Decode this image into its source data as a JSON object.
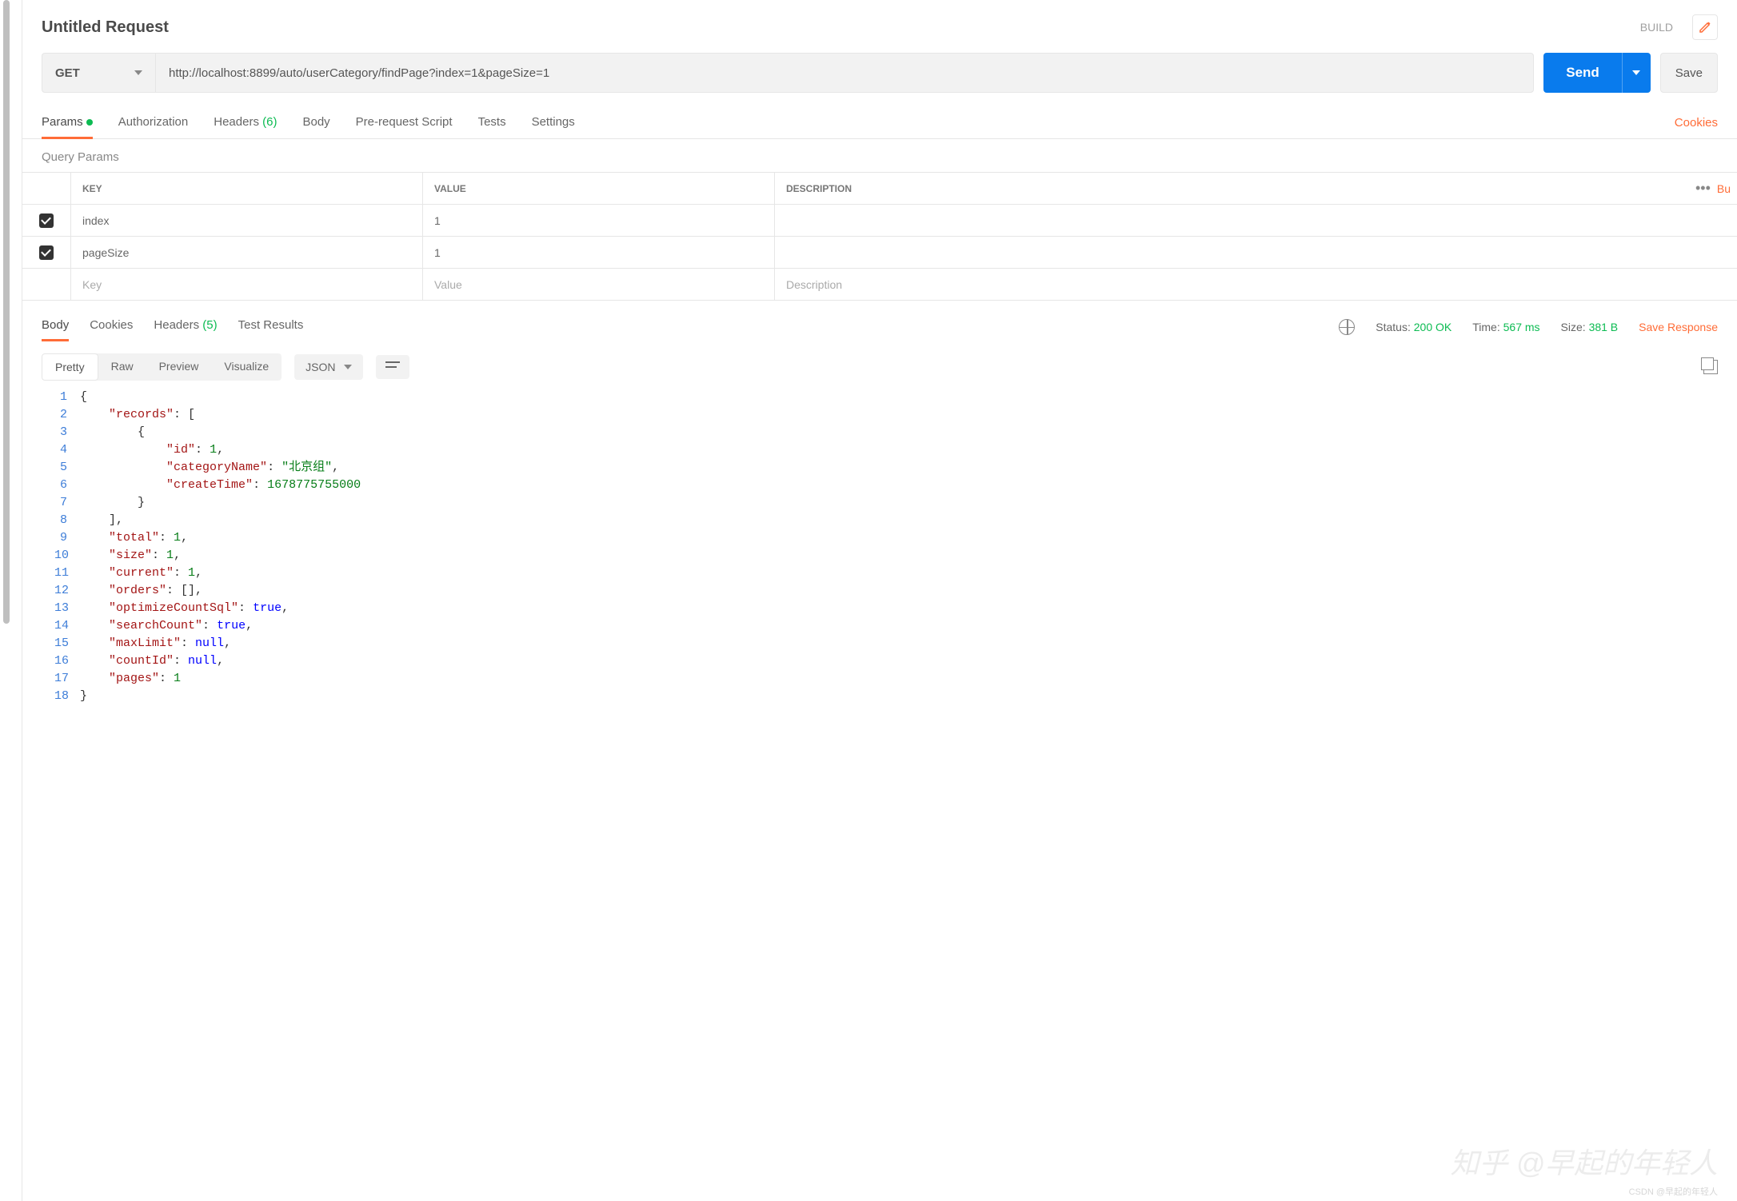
{
  "header": {
    "title": "Untitled Request",
    "build_label": "BUILD"
  },
  "request": {
    "method": "GET",
    "url": "http://localhost:8899/auto/userCategory/findPage?index=1&pageSize=1",
    "send_label": "Send",
    "save_label": "Save"
  },
  "request_tabs": {
    "params": "Params",
    "authorization": "Authorization",
    "headers": "Headers",
    "headers_count": "(6)",
    "body": "Body",
    "prerequest": "Pre-request Script",
    "tests": "Tests",
    "settings": "Settings",
    "cookies": "Cookies"
  },
  "params_section": {
    "title": "Query Params",
    "col_key": "KEY",
    "col_value": "VALUE",
    "col_desc": "DESCRIPTION",
    "bulk_short": "Bu",
    "rows": [
      {
        "checked": true,
        "key": "index",
        "value": "1",
        "desc": ""
      },
      {
        "checked": true,
        "key": "pageSize",
        "value": "1",
        "desc": ""
      }
    ],
    "ph_key": "Key",
    "ph_value": "Value",
    "ph_desc": "Description"
  },
  "response_tabs": {
    "body": "Body",
    "cookies": "Cookies",
    "headers": "Headers",
    "headers_count": "(5)",
    "tests": "Test Results"
  },
  "response_status": {
    "status_label": "Status:",
    "status_value": "200 OK",
    "time_label": "Time:",
    "time_value": "567 ms",
    "size_label": "Size:",
    "size_value": "381 B",
    "save_response": "Save Response"
  },
  "body_controls": {
    "pretty": "Pretty",
    "raw": "Raw",
    "preview": "Preview",
    "visualize": "Visualize",
    "format": "JSON"
  },
  "response_body": {
    "records": [
      {
        "id": 1,
        "categoryName": "北京组",
        "createTime": 1678775755000
      }
    ],
    "total": 1,
    "size": 1,
    "current": 1,
    "orders": [],
    "optimizeCountSql": true,
    "searchCount": true,
    "maxLimit": null,
    "countId": null,
    "pages": 1
  },
  "code_lines": [
    {
      "n": 1,
      "indent": 0,
      "tokens": [
        {
          "t": "punct",
          "v": "{"
        }
      ]
    },
    {
      "n": 2,
      "indent": 1,
      "tokens": [
        {
          "t": "key",
          "v": "\"records\""
        },
        {
          "t": "punct",
          "v": ": ["
        }
      ]
    },
    {
      "n": 3,
      "indent": 2,
      "tokens": [
        {
          "t": "punct",
          "v": "{"
        }
      ]
    },
    {
      "n": 4,
      "indent": 3,
      "tokens": [
        {
          "t": "key",
          "v": "\"id\""
        },
        {
          "t": "punct",
          "v": ": "
        },
        {
          "t": "num",
          "v": "1"
        },
        {
          "t": "punct",
          "v": ","
        }
      ]
    },
    {
      "n": 5,
      "indent": 3,
      "tokens": [
        {
          "t": "key",
          "v": "\"categoryName\""
        },
        {
          "t": "punct",
          "v": ": "
        },
        {
          "t": "str",
          "v": "\"北京组\""
        },
        {
          "t": "punct",
          "v": ","
        }
      ]
    },
    {
      "n": 6,
      "indent": 3,
      "tokens": [
        {
          "t": "key",
          "v": "\"createTime\""
        },
        {
          "t": "punct",
          "v": ": "
        },
        {
          "t": "num",
          "v": "1678775755000"
        }
      ]
    },
    {
      "n": 7,
      "indent": 2,
      "tokens": [
        {
          "t": "punct",
          "v": "}"
        }
      ]
    },
    {
      "n": 8,
      "indent": 1,
      "tokens": [
        {
          "t": "punct",
          "v": "],"
        }
      ]
    },
    {
      "n": 9,
      "indent": 1,
      "tokens": [
        {
          "t": "key",
          "v": "\"total\""
        },
        {
          "t": "punct",
          "v": ": "
        },
        {
          "t": "num",
          "v": "1"
        },
        {
          "t": "punct",
          "v": ","
        }
      ]
    },
    {
      "n": 10,
      "indent": 1,
      "tokens": [
        {
          "t": "key",
          "v": "\"size\""
        },
        {
          "t": "punct",
          "v": ": "
        },
        {
          "t": "num",
          "v": "1"
        },
        {
          "t": "punct",
          "v": ","
        }
      ]
    },
    {
      "n": 11,
      "indent": 1,
      "tokens": [
        {
          "t": "key",
          "v": "\"current\""
        },
        {
          "t": "punct",
          "v": ": "
        },
        {
          "t": "num",
          "v": "1"
        },
        {
          "t": "punct",
          "v": ","
        }
      ]
    },
    {
      "n": 12,
      "indent": 1,
      "tokens": [
        {
          "t": "key",
          "v": "\"orders\""
        },
        {
          "t": "punct",
          "v": ": [],"
        }
      ]
    },
    {
      "n": 13,
      "indent": 1,
      "tokens": [
        {
          "t": "key",
          "v": "\"optimizeCountSql\""
        },
        {
          "t": "punct",
          "v": ": "
        },
        {
          "t": "bool",
          "v": "true"
        },
        {
          "t": "punct",
          "v": ","
        }
      ]
    },
    {
      "n": 14,
      "indent": 1,
      "tokens": [
        {
          "t": "key",
          "v": "\"searchCount\""
        },
        {
          "t": "punct",
          "v": ": "
        },
        {
          "t": "bool",
          "v": "true"
        },
        {
          "t": "punct",
          "v": ","
        }
      ]
    },
    {
      "n": 15,
      "indent": 1,
      "tokens": [
        {
          "t": "key",
          "v": "\"maxLimit\""
        },
        {
          "t": "punct",
          "v": ": "
        },
        {
          "t": "null",
          "v": "null"
        },
        {
          "t": "punct",
          "v": ","
        }
      ]
    },
    {
      "n": 16,
      "indent": 1,
      "tokens": [
        {
          "t": "key",
          "v": "\"countId\""
        },
        {
          "t": "punct",
          "v": ": "
        },
        {
          "t": "null",
          "v": "null"
        },
        {
          "t": "punct",
          "v": ","
        }
      ]
    },
    {
      "n": 17,
      "indent": 1,
      "tokens": [
        {
          "t": "key",
          "v": "\"pages\""
        },
        {
          "t": "punct",
          "v": ": "
        },
        {
          "t": "num",
          "v": "1"
        }
      ]
    },
    {
      "n": 18,
      "indent": 0,
      "tokens": [
        {
          "t": "punct",
          "v": "}"
        }
      ]
    }
  ],
  "watermark": "知乎 @早起的年轻人",
  "watermark_sub": "CSDN @早起的年轻人"
}
